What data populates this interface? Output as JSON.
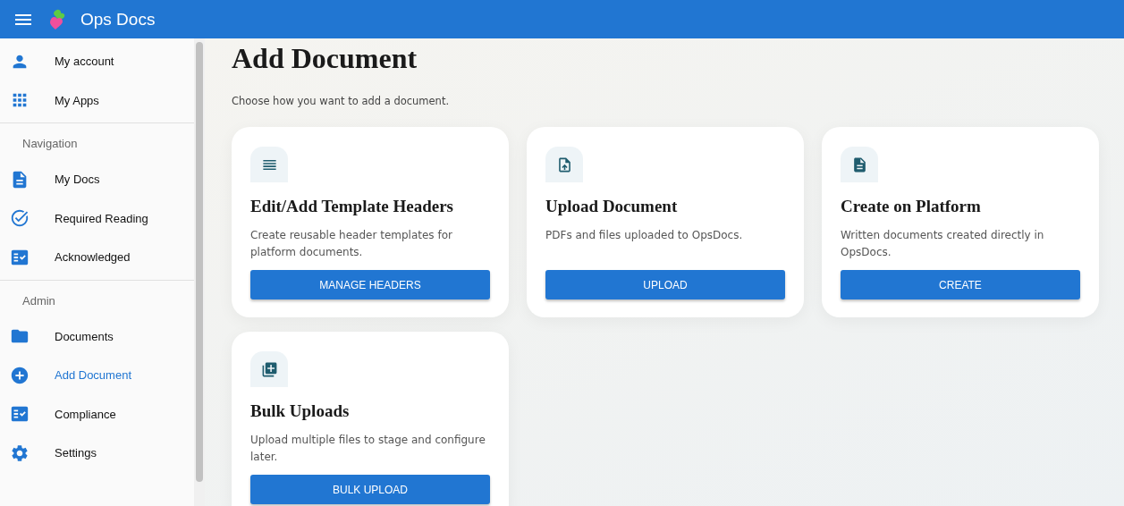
{
  "app_bar": {
    "title": "Ops Docs"
  },
  "sidebar": {
    "groups": [
      {
        "items": [
          {
            "label": "My account",
            "selected": false
          },
          {
            "label": "My Apps",
            "selected": false
          }
        ]
      },
      {
        "heading": "Navigation",
        "items": [
          {
            "label": "My Docs",
            "selected": false
          },
          {
            "label": "Required Reading",
            "selected": false
          },
          {
            "label": "Acknowledged",
            "selected": false
          }
        ]
      },
      {
        "heading": "Admin",
        "items": [
          {
            "label": "Documents",
            "selected": false
          },
          {
            "label": "Add Document",
            "selected": true
          },
          {
            "label": "Compliance",
            "selected": false
          },
          {
            "label": "Settings",
            "selected": false
          }
        ]
      }
    ]
  },
  "page": {
    "title": "Add Document",
    "subtitle": "Choose how you want to add a document.",
    "cards": [
      {
        "title": "Edit/Add Template Headers",
        "description": "Create reusable header templates for platform documents.",
        "button": "MANAGE HEADERS"
      },
      {
        "title": "Upload Document",
        "description": "PDFs and files uploaded to OpsDocs.",
        "button": "UPLOAD"
      },
      {
        "title": "Create on Platform",
        "description": "Written documents created directly in OpsDocs.",
        "button": "CREATE"
      },
      {
        "title": "Bulk Uploads",
        "description": "Upload multiple files to stage and configure later.",
        "button": "BULK UPLOAD"
      }
    ]
  }
}
